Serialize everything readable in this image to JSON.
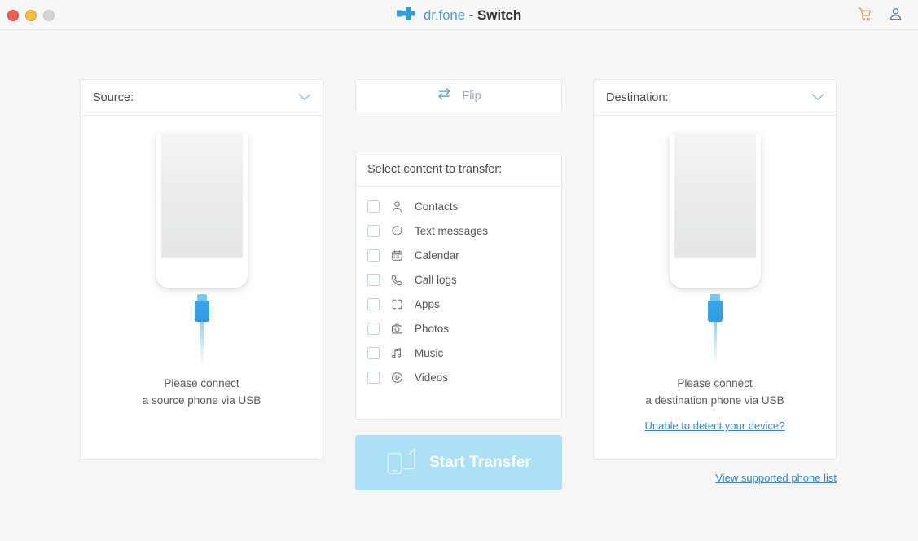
{
  "window": {
    "controls": [
      {
        "name": "close",
        "color": "#ef5f56"
      },
      {
        "name": "minimize",
        "color": "#f1bf42"
      },
      {
        "name": "maximize",
        "color": "#d4d4d4"
      }
    ],
    "brand": {
      "logo_icon": "dr-fone-cross-logo",
      "part1": "dr.fone",
      "separator": " - ",
      "part2": "Switch"
    },
    "actions": [
      {
        "name": "cart-icon",
        "label": "Cart",
        "color": "#d99a54"
      },
      {
        "name": "account-icon",
        "label": "Account",
        "color": "#5b7a96"
      }
    ]
  },
  "source_panel": {
    "header_label": "Source:",
    "dropdown_icon": "chevron-down-icon",
    "phone_icon": "phone-outline-illustration",
    "connector_icon": "usb-connector-icon",
    "message_line1": "Please connect",
    "message_line2": "a source phone via USB"
  },
  "destination_panel": {
    "header_label": "Destination:",
    "dropdown_icon": "chevron-down-icon",
    "phone_icon": "phone-outline-illustration",
    "connector_icon": "usb-connector-icon",
    "message_line1": "Please connect",
    "message_line2": "a destination phone via USB",
    "detect_link": "Unable to detect your device?"
  },
  "flip": {
    "label": "Flip",
    "icon": "flip-swap-icon"
  },
  "content": {
    "header_label": "Select content to transfer:",
    "items": [
      {
        "label": "Contacts",
        "icon": "contact-person-icon",
        "checked": false
      },
      {
        "label": "Text messages",
        "icon": "speech-bubble-icon",
        "checked": false
      },
      {
        "label": "Calendar",
        "icon": "calendar-icon",
        "checked": false
      },
      {
        "label": "Call logs",
        "icon": "phone-call-icon",
        "checked": false
      },
      {
        "label": "Apps",
        "icon": "apps-grid-icon",
        "checked": false
      },
      {
        "label": "Photos",
        "icon": "camera-icon",
        "checked": false
      },
      {
        "label": "Music",
        "icon": "music-note-icon",
        "checked": false
      },
      {
        "label": "Videos",
        "icon": "play-circle-icon",
        "checked": false
      }
    ]
  },
  "start_transfer": {
    "label": "Start Transfer",
    "icon": "two-phones-transfer-icon",
    "enabled": false,
    "bg_color": "#ace0f5"
  },
  "footer": {
    "supported_link": "View supported phone list"
  },
  "colors": {
    "accent_blue": "#38a6e8",
    "link_blue": "#3a87c8",
    "page_bg": "#f6f6f7",
    "panel_bg": "#ffffff"
  }
}
